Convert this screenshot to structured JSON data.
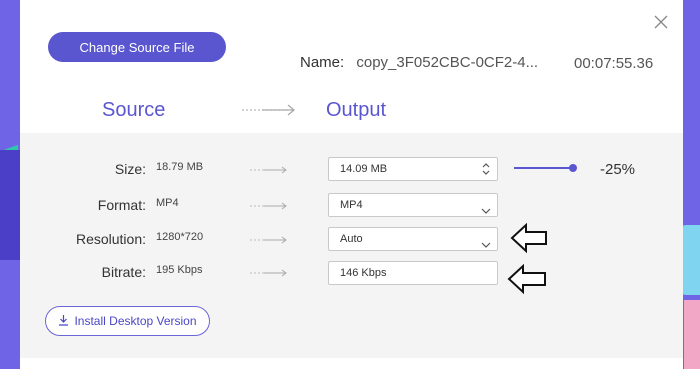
{
  "header": {
    "change_source_label": "Change Source File",
    "name_label": "Name:",
    "name_value": "copy_3F052CBC-0CF2-4...",
    "duration": "00:07:55.36"
  },
  "columns": {
    "source": "Source",
    "output": "Output"
  },
  "rows": [
    {
      "label": "Size:",
      "source": "18.79  MB",
      "output": "14.09  MB"
    },
    {
      "label": "Format:",
      "source": "MP4",
      "output": "MP4"
    },
    {
      "label": "Resolution:",
      "source": "1280*720",
      "output": "Auto"
    },
    {
      "label": "Bitrate:",
      "source": "195  Kbps",
      "output": "146 Kbps"
    }
  ],
  "size_slider": {
    "percent_label": "-25%",
    "level": 1.0
  },
  "install_label": "Install Desktop Version",
  "colors": {
    "accent": "#5a56cf",
    "panel": "#f4f4f4",
    "background": "#6f63e6"
  },
  "icons": {
    "close": "close-icon",
    "arrow": "arrow-right-icon",
    "stepper": "stepper-icon",
    "chevron": "chevron-down-icon",
    "download": "download-icon",
    "callout": "outline-arrow-left-icon"
  }
}
